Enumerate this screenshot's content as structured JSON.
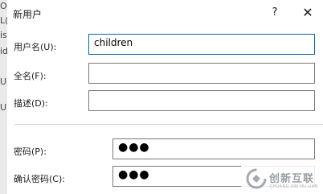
{
  "background_window": {
    "fragments": [
      "Ol",
      "L(",
      "is",
      "id",
      "U",
      "U"
    ]
  },
  "dialog": {
    "title": "新用户",
    "help_glyph": "?",
    "close_glyph": "✕"
  },
  "form": {
    "username_label": "用户名(U):",
    "username_value": "children",
    "fullname_label": "全名(F):",
    "fullname_value": "",
    "description_label": "描述(D):",
    "description_value": "",
    "password_label": "密码(P):",
    "password_value": "●●●",
    "confirm_label": "确认密码(C):",
    "confirm_value": "●●●"
  },
  "watermark": {
    "text": "创新互联",
    "subtext": "CHUANG XIN HU LIAN"
  }
}
